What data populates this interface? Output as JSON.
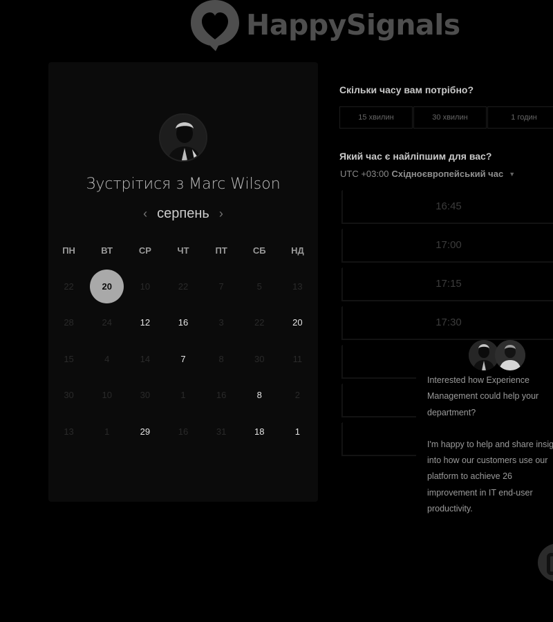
{
  "brand": {
    "name": "HappySignals",
    "logo_icon": "heart-speech-bubble-icon"
  },
  "calendar": {
    "title": "Зустрітися з Marc Wilson",
    "month": "серпень",
    "prev_icon": "chevron-left-icon",
    "next_icon": "chevron-right-icon",
    "weekdays": [
      "ПН",
      "ВТ",
      "СР",
      "ЧТ",
      "ПТ",
      "СБ",
      "НД"
    ],
    "weeks": [
      [
        {
          "day": "22",
          "available": false
        },
        {
          "day": "20",
          "available": true,
          "selected": true
        },
        {
          "day": "10",
          "available": false
        },
        {
          "day": "22",
          "available": false
        },
        {
          "day": "7",
          "available": false
        },
        {
          "day": "5",
          "available": false
        },
        {
          "day": "13",
          "available": false
        }
      ],
      [
        {
          "day": "28",
          "available": false
        },
        {
          "day": "24",
          "available": false
        },
        {
          "day": "12",
          "available": true
        },
        {
          "day": "16",
          "available": true
        },
        {
          "day": "3",
          "available": false
        },
        {
          "day": "22",
          "available": false
        },
        {
          "day": "20",
          "available": true
        }
      ],
      [
        {
          "day": "15",
          "available": false
        },
        {
          "day": "4",
          "available": false
        },
        {
          "day": "14",
          "available": false
        },
        {
          "day": "7",
          "available": true
        },
        {
          "day": "8",
          "available": false
        },
        {
          "day": "30",
          "available": false
        },
        {
          "day": "11",
          "available": false
        }
      ],
      [
        {
          "day": "30",
          "available": false
        },
        {
          "day": "10",
          "available": false
        },
        {
          "day": "30",
          "available": false
        },
        {
          "day": "1",
          "available": false
        },
        {
          "day": "16",
          "available": false
        },
        {
          "day": "8",
          "available": true
        },
        {
          "day": "2",
          "available": false
        }
      ],
      [
        {
          "day": "13",
          "available": false
        },
        {
          "day": "1",
          "available": false
        },
        {
          "day": "29",
          "available": true
        },
        {
          "day": "16",
          "available": false
        },
        {
          "day": "31",
          "available": false
        },
        {
          "day": "18",
          "available": true
        },
        {
          "day": "1",
          "available": true
        }
      ]
    ]
  },
  "duration": {
    "question": "Скільки часу вам потрібно?",
    "options": [
      "15 хвилин",
      "30 хвилин",
      "1 годин"
    ]
  },
  "time": {
    "question": "Який час є найліпшим для вас?",
    "tz_offset": "UTC +03:00",
    "tz_name": "Східноєвропейський час",
    "slots": [
      "16:45",
      "17:00",
      "17:15",
      "17:30",
      "",
      "",
      ""
    ]
  },
  "chat": {
    "message_1": "Interested how Experience Management could help your department?",
    "message_2": "I'm happy to help and share insight into how our customers use our platform to achieve 26 improvement in IT end-user productivity.",
    "launcher_icon": "chat-bubble-icon"
  }
}
